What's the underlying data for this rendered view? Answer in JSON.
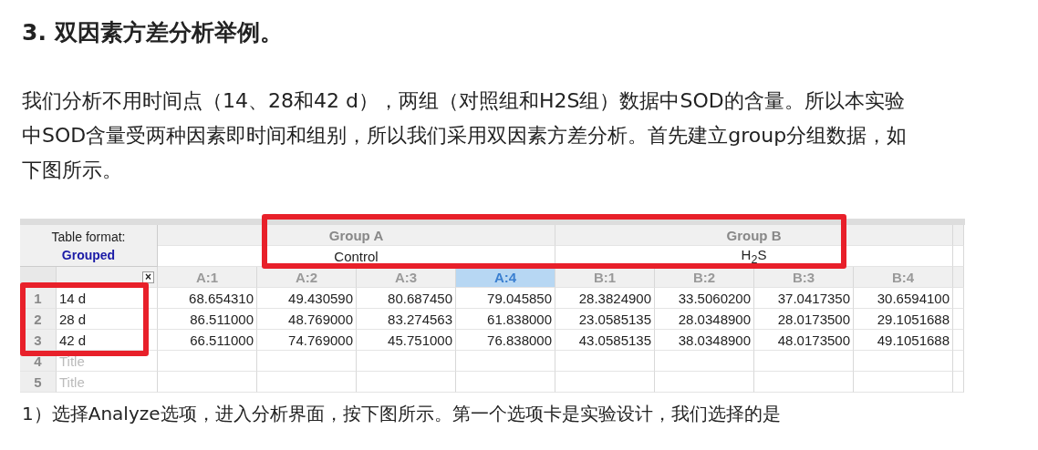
{
  "heading": "3. 双因素方差分析举例。",
  "paragraph": "我们分析不用时间点（14、28和42 d），两组（对照组和H2S组）数据中SOD的含量。所以本实验中SOD含量受两种因素即时间和组别，所以我们采用双因素方差分析。首先建立group分组数据，如下图所示。",
  "figure": {
    "format_label": "Table format:",
    "format_value": "Grouped",
    "close": "×",
    "groups": [
      {
        "name": "Group A",
        "subtitle": "Control"
      },
      {
        "name": "Group B",
        "subtitle": "H$_{2}$S"
      }
    ],
    "columns": [
      {
        "label": "A:1",
        "selected": false
      },
      {
        "label": "A:2",
        "selected": false
      },
      {
        "label": "A:3",
        "selected": false
      },
      {
        "label": "A:4",
        "selected": true
      },
      {
        "label": "B:1",
        "selected": false
      },
      {
        "label": "B:2",
        "selected": false
      },
      {
        "label": "B:3",
        "selected": false
      },
      {
        "label": "B:4",
        "selected": false
      }
    ],
    "rows": [
      {
        "number": "1",
        "label": "14 d",
        "cells": [
          "68.654310",
          "49.430590",
          "80.687450",
          "79.045850",
          "28.3824900",
          "33.5060200",
          "37.0417350",
          "30.6594100"
        ]
      },
      {
        "number": "2",
        "label": "28 d",
        "cells": [
          "86.511000",
          "48.769000",
          "83.274563",
          "61.838000",
          "23.0585135",
          "28.0348900",
          "28.0173500",
          "29.1051688"
        ]
      },
      {
        "number": "3",
        "label": "42 d",
        "cells": [
          "66.511000",
          "74.769000",
          "45.751000",
          "76.838000",
          "43.0585135",
          "38.0348900",
          "48.0173500",
          "49.1051688"
        ]
      },
      {
        "number": "4",
        "placeholder": "Title"
      },
      {
        "number": "5",
        "placeholder": "Title"
      }
    ]
  },
  "next_step": "1）选择Analyze选项，进入分析界面，按下图所示。第一个选项卡是实验设计，我们选择的是"
}
